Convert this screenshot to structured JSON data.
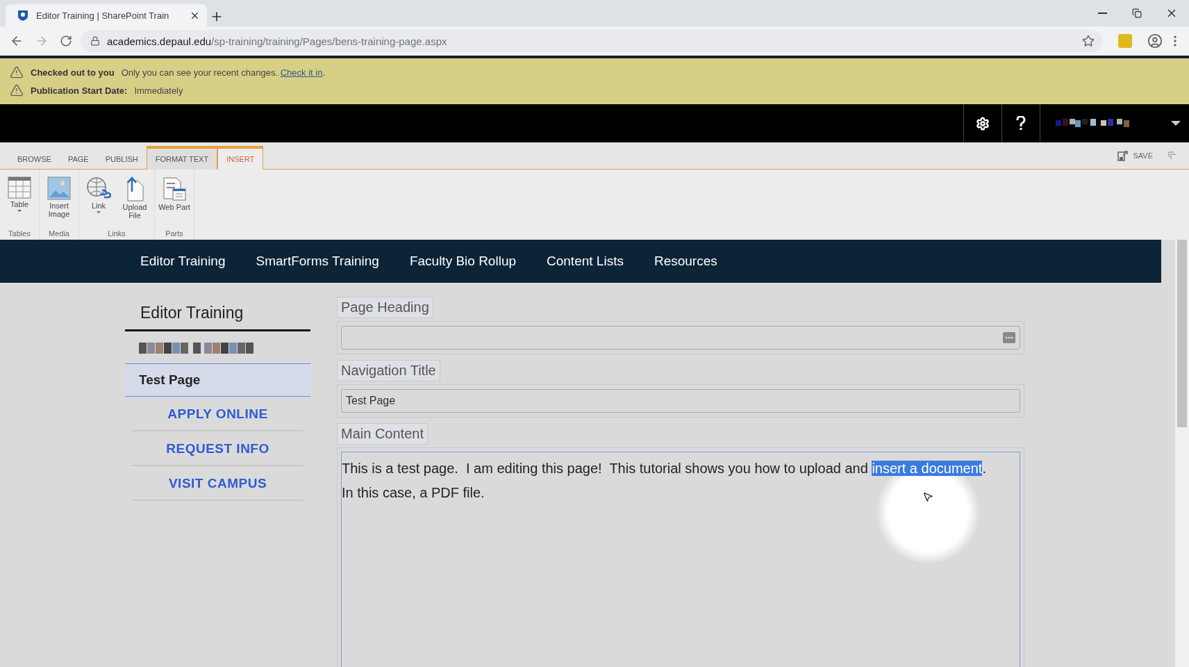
{
  "browser": {
    "tab_title": "Editor Training | SharePoint Train",
    "url_host": "academics.depaul.edu",
    "url_path": "/sp-training/training/Pages/bens-training-page.aspx"
  },
  "status_messages": [
    {
      "title": "Checked out to you",
      "text": "Only you can see your recent changes.",
      "link": "Check it in",
      "after": "."
    },
    {
      "title": "Publication Start Date:",
      "text": "Immediately"
    }
  ],
  "ribbon": {
    "tabs": [
      {
        "label": "BROWSE",
        "contextual": false,
        "selected": false
      },
      {
        "label": "PAGE",
        "contextual": false,
        "selected": false
      },
      {
        "label": "PUBLISH",
        "contextual": false,
        "selected": false
      },
      {
        "label": "FORMAT TEXT",
        "contextual": true,
        "selected": false
      },
      {
        "label": "INSERT",
        "contextual": true,
        "selected": true
      }
    ],
    "save": "SAVE",
    "groups": [
      {
        "name": "Tables",
        "buttons": [
          {
            "label": "Table",
            "kind": "table",
            "dropdown": true
          }
        ]
      },
      {
        "name": "Media",
        "buttons": [
          {
            "label": "Insert Image",
            "kind": "image",
            "dropdown": false
          }
        ]
      },
      {
        "name": "Links",
        "buttons": [
          {
            "label": "Link",
            "kind": "link",
            "dropdown": true
          },
          {
            "label": "Upload File",
            "kind": "upload",
            "dropdown": false
          }
        ]
      },
      {
        "name": "Parts",
        "buttons": [
          {
            "label": "Web Part",
            "kind": "webpart",
            "dropdown": false
          }
        ]
      }
    ]
  },
  "top_nav": [
    "Editor Training",
    "SmartForms Training",
    "Faculty Bio Rollup",
    "Content Lists",
    "Resources"
  ],
  "left_nav": {
    "title": "Editor Training",
    "items": [
      {
        "label": "Test Page",
        "selected": true
      }
    ],
    "actions": [
      "APPLY ONLINE",
      "REQUEST INFO",
      "VISIT CAMPUS"
    ]
  },
  "fields": [
    {
      "label": "Page Heading",
      "kind": "heading"
    },
    {
      "label": "Navigation Title",
      "value": "Test Page",
      "kind": "text"
    }
  ],
  "main_content": {
    "label": "Main Content",
    "lines": [
      {
        "before": "This is a test page.  I am editing this page!  This tutorial shows you how to upload and ",
        "selection": "insert a document",
        "after": "."
      },
      {
        "before": "In this case, a PDF file."
      }
    ]
  }
}
